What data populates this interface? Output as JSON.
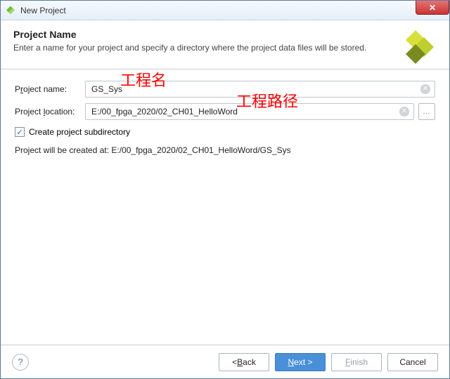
{
  "window": {
    "title": "New Project"
  },
  "header": {
    "heading": "Project Name",
    "description": "Enter a name for your project and specify a directory where the project data files will be stored."
  },
  "form": {
    "name_label_pre": "P",
    "name_label_u": "r",
    "name_label_post": "oject name:",
    "name_value": "GS_Sys",
    "loc_label_pre": "Project ",
    "loc_label_u": "l",
    "loc_label_post": "ocation:",
    "loc_value": "E:/00_fpga_2020/02_CH01_HelloWord",
    "browse_label": "...",
    "subdir_label": "Create project subdirectory",
    "subdir_checked": "✓",
    "summary": "Project will be created at: E:/00_fpga_2020/02_CH01_HelloWord/GS_Sys"
  },
  "annotations": {
    "name": "工程名",
    "path": "工程路径"
  },
  "footer": {
    "help": "?",
    "back_pre": "< ",
    "back_u": "B",
    "back_post": "ack",
    "next_u": "N",
    "next_post": "ext >",
    "finish_u": "F",
    "finish_post": "inish",
    "cancel": "Cancel"
  }
}
